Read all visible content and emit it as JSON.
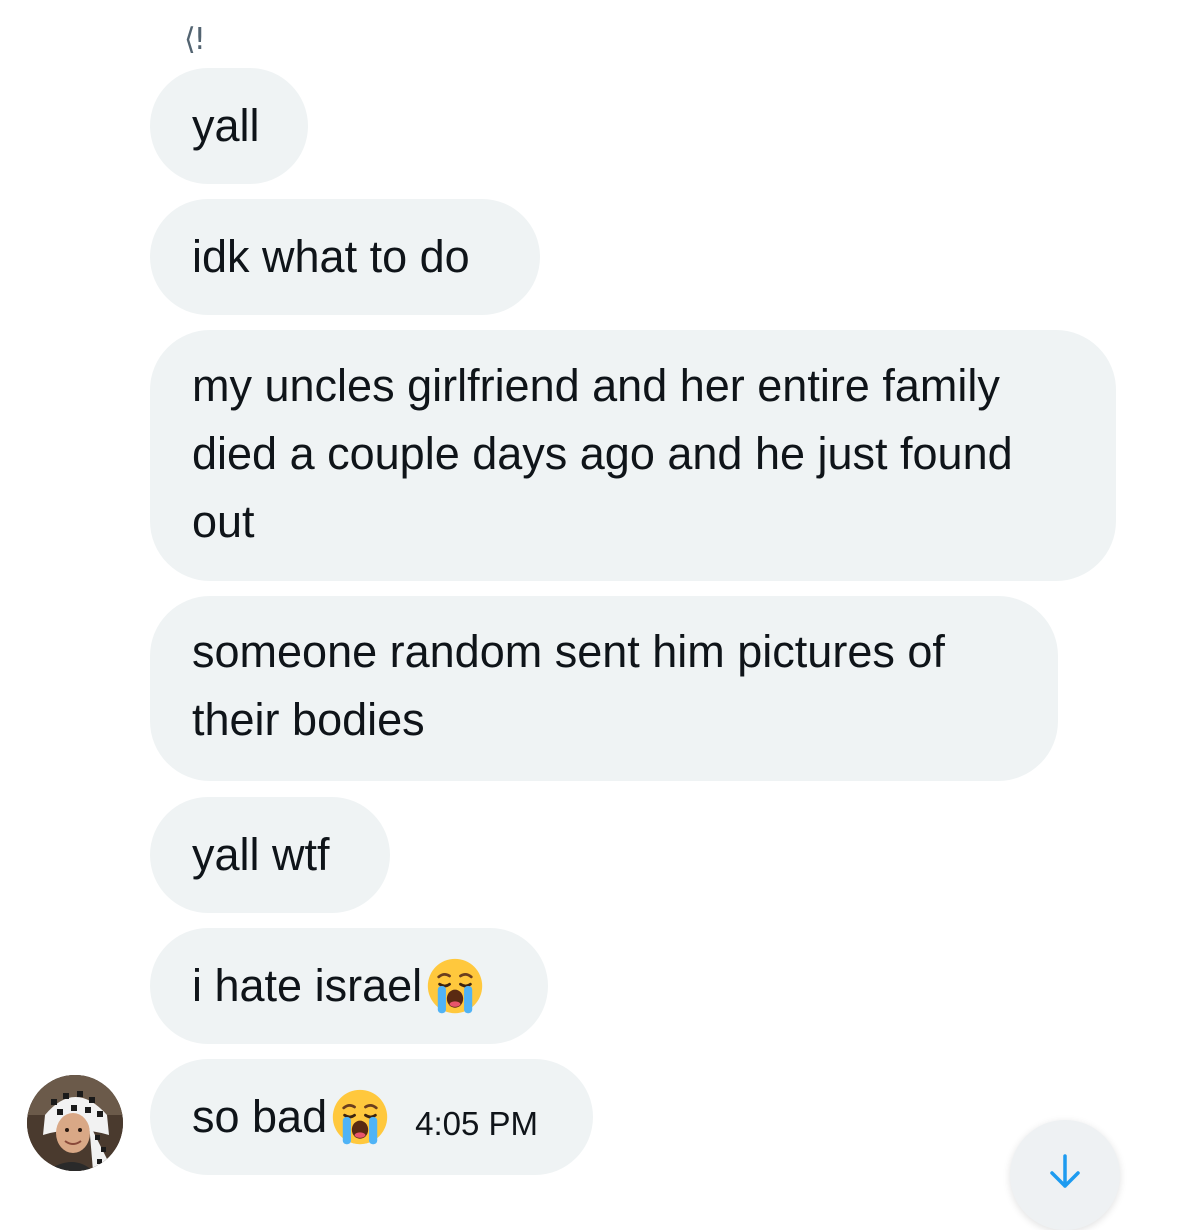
{
  "header_glyph": "⟨!",
  "messages": [
    {
      "text": "yall"
    },
    {
      "text": "idk what to do"
    },
    {
      "text": "my uncles girlfriend and her entire family died a couple days ago and he just found out"
    },
    {
      "text": "someone random sent him pictures of their bodies"
    },
    {
      "text": "yall wtf"
    },
    {
      "text": "i hate israel",
      "emoji": "loudly-crying-face"
    },
    {
      "text": "so bad",
      "emoji": "loudly-crying-face",
      "time": "4:05 PM"
    }
  ],
  "colors": {
    "bubble_bg": "#eff3f4",
    "accent": "#1d9bf0",
    "text": "#0f1419"
  },
  "icons": {
    "scroll_down": "arrow-down-icon",
    "emoji": "loudly-crying-face-icon"
  }
}
